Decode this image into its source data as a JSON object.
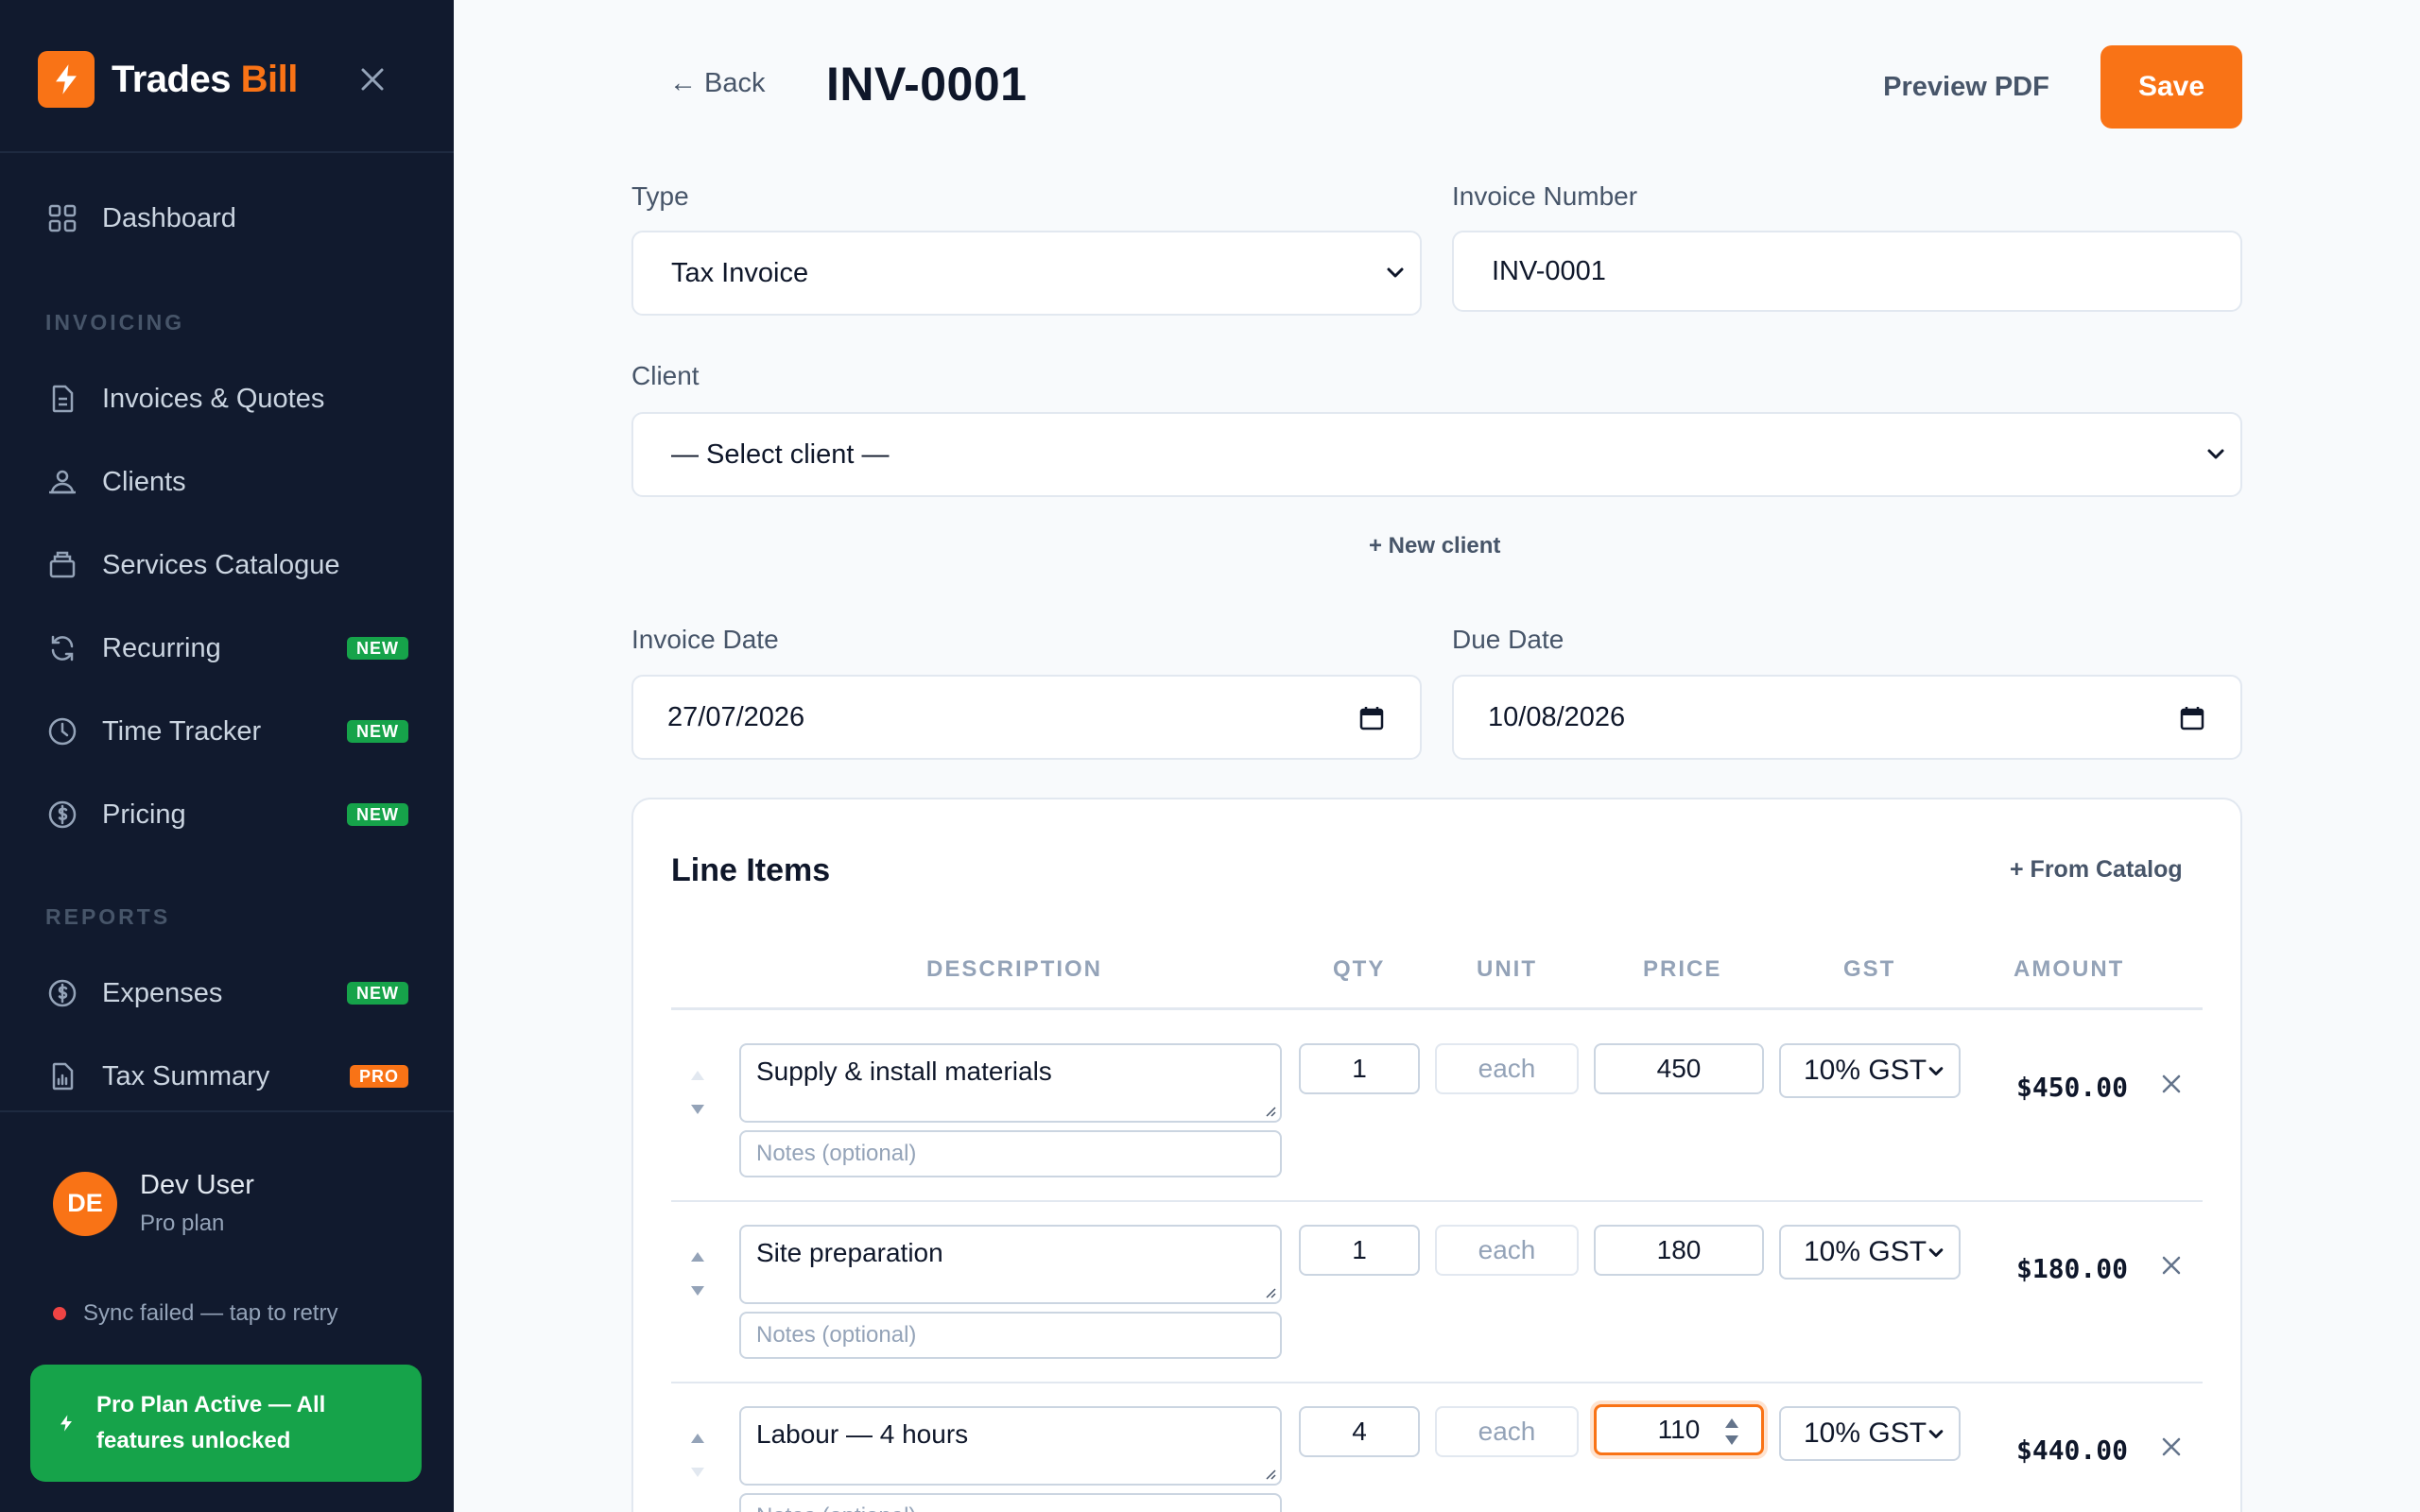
{
  "brand": {
    "name_main": "Trades",
    "name_accent": "Bill"
  },
  "sidebar": {
    "items": [
      {
        "label": "Dashboard",
        "icon": "grid-icon"
      },
      {
        "label": "Invoices & Quotes",
        "icon": "document-icon"
      },
      {
        "label": "Clients",
        "icon": "users-icon"
      },
      {
        "label": "Services Catalogue",
        "icon": "box-icon"
      },
      {
        "label": "Recurring",
        "icon": "refresh-icon",
        "badge": "NEW"
      },
      {
        "label": "Time Tracker",
        "icon": "clock-icon",
        "badge": "NEW"
      },
      {
        "label": "Pricing",
        "icon": "dollar-icon",
        "badge": "NEW"
      },
      {
        "label": "Expenses",
        "icon": "dollar-icon",
        "badge": "NEW"
      },
      {
        "label": "Tax Summary",
        "icon": "chart-document-icon",
        "badge": "PRO"
      }
    ],
    "sections": {
      "invoicing": "INVOICING",
      "reports": "REPORTS"
    },
    "user": {
      "initials": "DE",
      "name": "Dev User",
      "plan": "Pro plan"
    },
    "sync_status": "Sync failed — tap to retry",
    "pro_banner": "Pro Plan Active — All features unlocked"
  },
  "header": {
    "back_label": "← Back",
    "title": "INV-0001",
    "preview_label": "Preview PDF",
    "save_label": "Save"
  },
  "form": {
    "type_label": "Type",
    "type_value": "Tax Invoice",
    "invoice_number_label": "Invoice Number",
    "invoice_number_value": "INV-0001",
    "client_label": "Client",
    "client_value": "— Select client —",
    "new_client_label": "+ New client",
    "invoice_date_label": "Invoice Date",
    "invoice_date_value": "27/07/2026",
    "due_date_label": "Due Date",
    "due_date_value": "10/08/2026"
  },
  "line_items": {
    "title": "Line Items",
    "from_catalog_label": "+ From Catalog",
    "columns": [
      "DESCRIPTION",
      "QTY",
      "UNIT",
      "PRICE",
      "GST",
      "AMOUNT"
    ],
    "notes_placeholder": "Notes (optional)",
    "rows": [
      {
        "description": "Supply & install materials",
        "qty": "1",
        "unit": "each",
        "price": "450",
        "gst": "10% GST",
        "amount": "$450.00"
      },
      {
        "description": "Site preparation",
        "qty": "1",
        "unit": "each",
        "price": "180",
        "gst": "10% GST",
        "amount": "$180.00"
      },
      {
        "description": "Labour — 4 hours",
        "qty": "4",
        "unit": "each",
        "price": "110",
        "gst": "10% GST",
        "amount": "$440.00"
      }
    ]
  },
  "colors": {
    "accent": "#f97316",
    "sidebar_bg": "#111a2e",
    "success": "#16a34a",
    "error": "#ef4444"
  }
}
